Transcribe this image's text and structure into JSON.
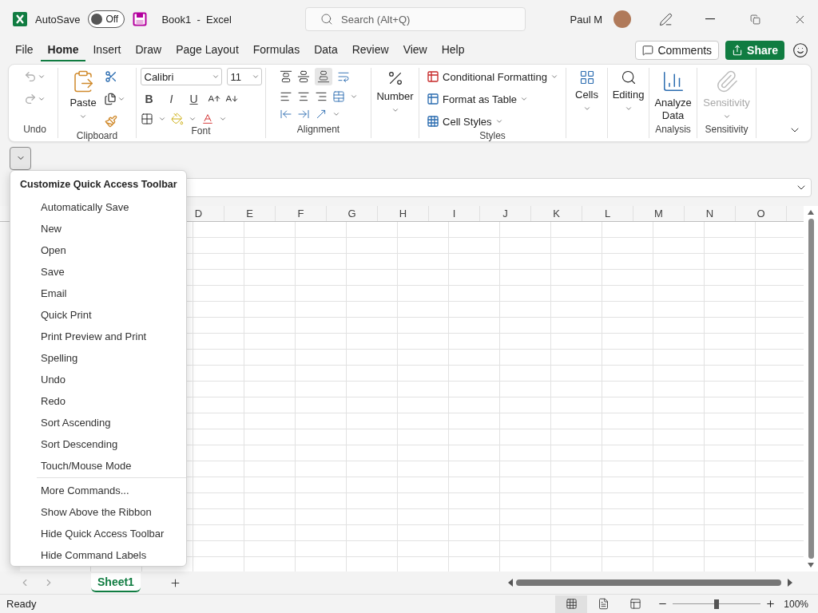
{
  "title_bar": {
    "autosave_label": "AutoSave",
    "autosave": {
      "on": false,
      "text": "Off"
    },
    "title": "Book1  -  Excel",
    "search": {
      "placeholder": "Search (Alt+Q)"
    },
    "user": "Paul M"
  },
  "menu_tabs": [
    {
      "label": "File",
      "selected": false
    },
    {
      "label": "Home",
      "selected": true
    },
    {
      "label": "Insert",
      "selected": false
    },
    {
      "label": "Draw",
      "selected": false
    },
    {
      "label": "Page Layout",
      "selected": false
    },
    {
      "label": "Formulas",
      "selected": false
    },
    {
      "label": "Data",
      "selected": false
    },
    {
      "label": "Review",
      "selected": false
    },
    {
      "label": "View",
      "selected": false
    },
    {
      "label": "Help",
      "selected": false
    }
  ],
  "actions": {
    "comments": "Comments",
    "share": "Share"
  },
  "ribbon": {
    "groups": [
      {
        "kind": "undo",
        "label": "Undo"
      },
      {
        "kind": "clipboard",
        "label": "Clipboard",
        "paste": "Paste"
      },
      {
        "kind": "font",
        "label": "Font",
        "font_name": "Calibri",
        "font_size": "11",
        "styles": [
          "B",
          "I",
          "U"
        ]
      },
      {
        "kind": "alignment",
        "label": "Alignment"
      },
      {
        "kind": "number",
        "button": "Number"
      },
      {
        "kind": "styles",
        "label": "Styles",
        "items": [
          "Conditional Formatting",
          "Format as Table",
          "Cell Styles"
        ]
      },
      {
        "kind": "cells",
        "button": "Cells"
      },
      {
        "kind": "editing",
        "button": "Editing"
      },
      {
        "kind": "analyze",
        "label": "Analysis",
        "button": "Analyze Data"
      },
      {
        "kind": "sensitivity",
        "label": "Sensitivity",
        "button": "Sensitivity",
        "disabled": true
      }
    ]
  },
  "qat_menu": {
    "title": "Customize Quick Access Toolbar",
    "commands": [
      "Automatically Save",
      "New",
      "Open",
      "Save",
      "Email",
      "Quick Print",
      "Print Preview and Print",
      "Spelling",
      "Undo",
      "Redo",
      "Sort Ascending",
      "Sort Descending",
      "Touch/Mouse Mode"
    ],
    "options": [
      "More Commands...",
      "Show Above the Ribbon",
      "Hide Quick Access Toolbar",
      "Hide Command Labels"
    ]
  },
  "sheet": {
    "columns": [
      "D",
      "E",
      "F",
      "G",
      "H",
      "I",
      "J",
      "K",
      "L",
      "M",
      "N",
      "O"
    ]
  },
  "sheets": [
    {
      "label": "Sheet1",
      "selected": true
    }
  ],
  "status_bar": {
    "text": "Ready",
    "views": [
      {
        "kind": "normal",
        "selected": true
      },
      {
        "kind": "page_layout",
        "selected": false
      },
      {
        "kind": "page_break",
        "selected": false
      }
    ],
    "zoom_slider": {
      "level": 0.5
    },
    "zoom": "100%"
  }
}
